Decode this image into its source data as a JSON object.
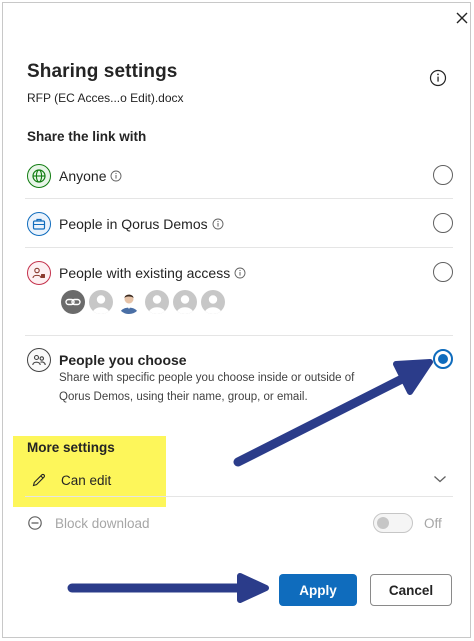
{
  "dialog": {
    "title": "Sharing settings",
    "filename": "RFP (EC Acces...o Edit).docx",
    "close_icon": "close-icon",
    "info_icon": "info-icon"
  },
  "share_section": {
    "heading": "Share the link with",
    "options": [
      {
        "label": "Anyone",
        "icon": "globe-icon",
        "has_info": true,
        "selected": false
      },
      {
        "label": "People in Qorus Demos",
        "icon": "briefcase-icon",
        "has_info": true,
        "selected": false
      },
      {
        "label": "People with existing access",
        "icon": "people-lock-icon",
        "has_info": true,
        "selected": false
      },
      {
        "label": "People you choose",
        "icon": "people-icon",
        "has_info": false,
        "selected": true,
        "description": "Share with specific people you choose inside or outside of Qorus Demos, using their name, group, or email."
      }
    ]
  },
  "more_settings": {
    "heading": "More settings",
    "permission_label": "Can edit",
    "permission_icon": "pencil-icon",
    "block_download_label": "Block download",
    "block_download_state": "Off"
  },
  "footer": {
    "apply_label": "Apply",
    "cancel_label": "Cancel"
  },
  "colors": {
    "accent": "#0f6cbd",
    "highlight": "#fdf65a",
    "annotation_arrow": "#2b3c8a"
  }
}
